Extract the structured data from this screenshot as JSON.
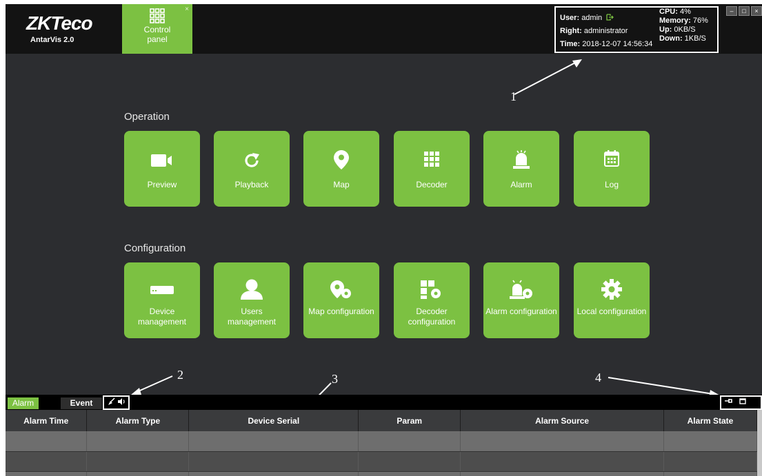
{
  "topbar": {
    "brand": "ZKTeco",
    "product": "AntarVis 2.0",
    "tab_label": "Control panel",
    "tab_close": "×"
  },
  "status": {
    "user_label": "User:",
    "user_value": "admin",
    "right_label": "Right:",
    "right_value": "administrator",
    "time_label": "Time:",
    "time_value": "2018-12-07 14:56:34",
    "cpu_label": "CPU:",
    "cpu_value": "4%",
    "memory_label": "Memory:",
    "memory_value": "76%",
    "up_label": "Up:",
    "up_value": "0KB/S",
    "down_label": "Down:",
    "down_value": "1KB/S"
  },
  "window_controls": [
    "–",
    "□",
    "×"
  ],
  "operation": {
    "title": "Operation",
    "items": [
      {
        "label": "Preview",
        "icon": "video-camera-icon"
      },
      {
        "label": "Playback",
        "icon": "refresh-icon"
      },
      {
        "label": "Map",
        "icon": "map-pin-icon"
      },
      {
        "label": "Decoder",
        "icon": "grid-icon"
      },
      {
        "label": "Alarm",
        "icon": "siren-icon"
      },
      {
        "label": "Log",
        "icon": "calendar-icon"
      }
    ]
  },
  "configuration": {
    "title": "Configuration",
    "items": [
      {
        "label": "Device management",
        "icon": "device-box-icon"
      },
      {
        "label": "Users management",
        "icon": "user-icon"
      },
      {
        "label": "Map configuration",
        "icon": "map-gear-icon"
      },
      {
        "label": "Decoder configuration",
        "icon": "grid-gear-icon"
      },
      {
        "label": "Alarm configuration",
        "icon": "siren-gear-icon"
      },
      {
        "label": "Local configuration",
        "icon": "gear-icon"
      }
    ]
  },
  "annotations": [
    "1",
    "2",
    "3",
    "4"
  ],
  "bottom": {
    "tab_alarm": "Alarm",
    "tab_event": "Event",
    "columns": [
      "Alarm Time",
      "Alarm Type",
      "Device Serial",
      "Param",
      "Alarm Source",
      "Alarm State"
    ]
  }
}
